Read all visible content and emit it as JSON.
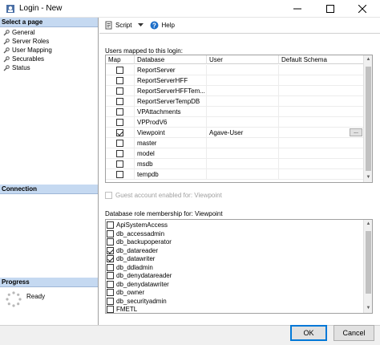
{
  "window": {
    "title": "Login - New"
  },
  "left": {
    "select_page_header": "Select a page",
    "pages": [
      "General",
      "Server Roles",
      "User Mapping",
      "Securables",
      "Status"
    ],
    "connection_header": "Connection",
    "progress_header": "Progress",
    "progress_status": "Ready"
  },
  "toolbar": {
    "script_label": "Script",
    "help_label": "Help"
  },
  "users_mapped": {
    "label": "Users mapped to this login:",
    "columns": [
      "Map",
      "Database",
      "User",
      "Default Schema"
    ],
    "rows": [
      {
        "map": false,
        "database": "ReportServer",
        "user": "",
        "schema": ""
      },
      {
        "map": false,
        "database": "ReportServerHFF",
        "user": "",
        "schema": ""
      },
      {
        "map": false,
        "database": "ReportServerHFFTem...",
        "user": "",
        "schema": ""
      },
      {
        "map": false,
        "database": "ReportServerTempDB",
        "user": "",
        "schema": ""
      },
      {
        "map": false,
        "database": "VPAttachments",
        "user": "",
        "schema": ""
      },
      {
        "map": false,
        "database": "VPProdV6",
        "user": "",
        "schema": ""
      },
      {
        "map": true,
        "database": "Viewpoint",
        "user": "Agave-User",
        "schema": ""
      },
      {
        "map": false,
        "database": "master",
        "user": "",
        "schema": ""
      },
      {
        "map": false,
        "database": "model",
        "user": "",
        "schema": ""
      },
      {
        "map": false,
        "database": "msdb",
        "user": "",
        "schema": ""
      },
      {
        "map": false,
        "database": "tempdb",
        "user": "",
        "schema": ""
      }
    ],
    "ellipsis_label": "..."
  },
  "guest_account": {
    "label": "Guest account enabled for: Viewpoint",
    "checked": false
  },
  "role_membership": {
    "label": "Database role membership for: Viewpoint",
    "roles": [
      {
        "name": "ApiSystemAccess",
        "checked": false
      },
      {
        "name": "db_accessadmin",
        "checked": false
      },
      {
        "name": "db_backupoperator",
        "checked": false
      },
      {
        "name": "db_datareader",
        "checked": true
      },
      {
        "name": "db_datawriter",
        "checked": true
      },
      {
        "name": "db_ddladmin",
        "checked": false
      },
      {
        "name": "db_denydatareader",
        "checked": false
      },
      {
        "name": "db_denydatawriter",
        "checked": false
      },
      {
        "name": "db_owner",
        "checked": false
      },
      {
        "name": "db_securityadmin",
        "checked": false
      },
      {
        "name": "FMETL",
        "checked": false
      }
    ]
  },
  "buttons": {
    "ok": "OK",
    "cancel": "Cancel"
  }
}
